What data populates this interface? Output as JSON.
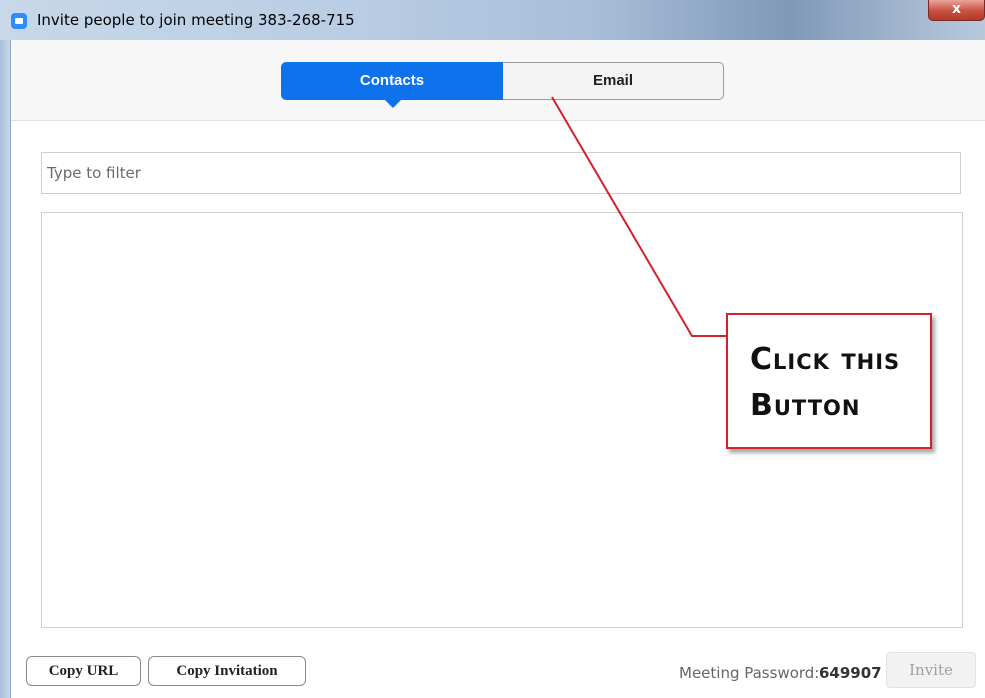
{
  "window": {
    "title": "Invite people to join meeting 383-268-715",
    "close_label": "x"
  },
  "tabs": [
    {
      "label": "Contacts",
      "active": true
    },
    {
      "label": "Email",
      "active": false
    }
  ],
  "filter": {
    "placeholder": "Type to filter",
    "value": ""
  },
  "footer": {
    "copy_url_label": "Copy URL",
    "copy_invitation_label": "Copy Invitation",
    "password_label": "Meeting Password:",
    "password_value": "649907",
    "invite_label": "Invite"
  },
  "annotation": {
    "line1": "Click this",
    "line2": "Button"
  },
  "colors": {
    "accent": "#0e72ed",
    "annotation_red": "#d4202a"
  },
  "icons": {
    "app": "zoom-camera-icon",
    "close": "close-icon"
  }
}
